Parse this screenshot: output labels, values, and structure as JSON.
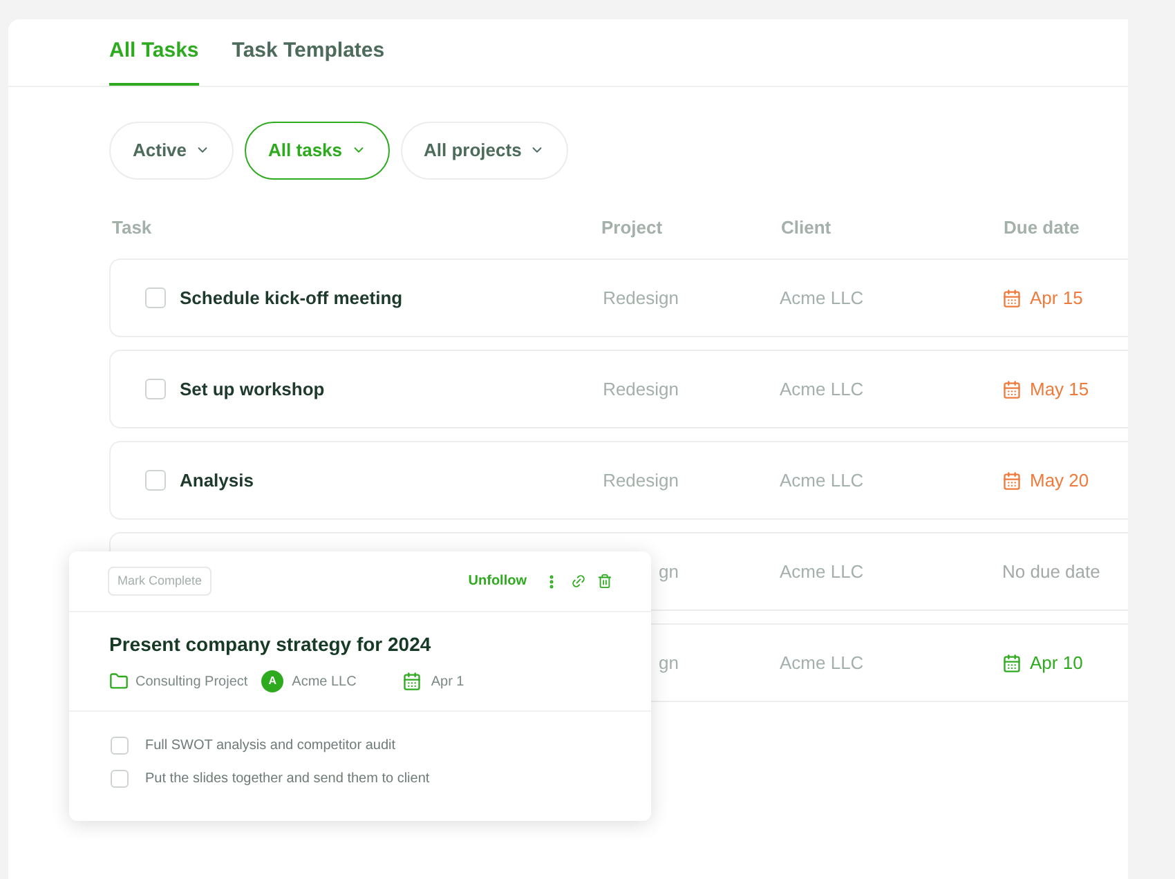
{
  "tabs": [
    {
      "label": "All Tasks",
      "selected": true
    },
    {
      "label": "Task Templates",
      "selected": false
    }
  ],
  "filters": [
    {
      "label": "Active",
      "selected": false
    },
    {
      "label": "All tasks",
      "selected": true
    },
    {
      "label": "All projects",
      "selected": false
    }
  ],
  "table": {
    "columns": [
      "Task",
      "Project",
      "Client",
      "Due date"
    ],
    "rows": [
      {
        "task": "Schedule kick-off meeting",
        "checked": false,
        "project": "Redesign",
        "client": "Acme LLC",
        "due": "Apr 15",
        "kind": "overdue"
      },
      {
        "task": "Set up workshop",
        "checked": false,
        "project": "Redesign",
        "client": "Acme LLC",
        "due": "May 15",
        "kind": "overdue"
      },
      {
        "task": "Analysis",
        "checked": false,
        "project": "Redesign",
        "client": "Acme LLC",
        "due": "May 20",
        "kind": "overdue"
      },
      {
        "project": "gn",
        "client": "Acme LLC",
        "due": "No due date",
        "kind": "none"
      },
      {
        "project": "gn",
        "client": "Acme LLC",
        "due": "Apr 10",
        "kind": "upcoming"
      }
    ]
  },
  "popup": {
    "mark_complete": "Mark Complete",
    "unfollow": "Unfollow",
    "title": "Present company strategy for 2024",
    "project": "Consulting Project",
    "client_initial": "A",
    "client": "Acme LLC",
    "due": "Apr 1",
    "subtasks": [
      {
        "label": "Full SWOT analysis and competitor audit",
        "checked": false
      },
      {
        "label": "Put the slides together and send them to client",
        "checked": false
      }
    ]
  }
}
